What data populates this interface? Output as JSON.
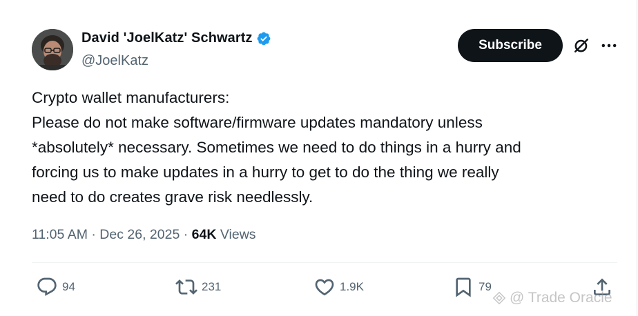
{
  "author": {
    "display_name": "David 'JoelKatz' Schwartz",
    "handle": "@JoelKatz",
    "verified": true
  },
  "header": {
    "subscribe_label": "Subscribe",
    "grok_icon": "grok-icon",
    "more_icon": "more-icon"
  },
  "post": {
    "lines": [
      "Crypto wallet manufacturers:",
      "Please do not make software/firmware updates mandatory unless",
      "*absolutely* necessary. Sometimes we need to do things in a hurry and",
      "forcing us to make updates in a hurry to get to do the thing we really",
      "need to do creates grave risk needlessly."
    ]
  },
  "meta": {
    "time": "11:05 AM",
    "separator": "·",
    "date": "Dec 26, 2025",
    "views_count": "64K",
    "views_label": "Views"
  },
  "actions": {
    "replies": "94",
    "reposts": "231",
    "likes": "1.9K",
    "bookmarks": "79"
  },
  "watermark": {
    "text": "@ Trade Oracle"
  },
  "colors": {
    "verified_blue": "#1d9bf0",
    "secondary_text": "#536471",
    "primary_text": "#0f1419"
  }
}
